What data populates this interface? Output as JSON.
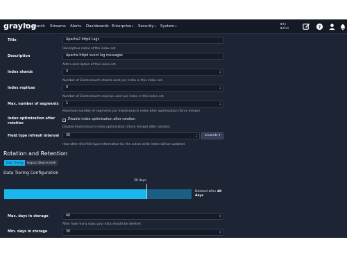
{
  "navbar": {
    "brand": "graylog",
    "items": [
      {
        "label": "Search",
        "dropdown": false
      },
      {
        "label": "Streams",
        "dropdown": false
      },
      {
        "label": "Alerts",
        "dropdown": false
      },
      {
        "label": "Dashboards",
        "dropdown": false
      },
      {
        "label": "Enterprise",
        "dropdown": true
      },
      {
        "label": "Security",
        "dropdown": true
      },
      {
        "label": "System",
        "dropdown": true
      }
    ],
    "throughput_in": "In",
    "throughput_out": "Out",
    "icons": [
      "edit-icon",
      "notifications-icon",
      "help-icon",
      "user-icon"
    ]
  },
  "form": {
    "title": {
      "label": "Title",
      "value": "Apache2 httpd Logs",
      "help": "Descriptive name of the index set."
    },
    "description": {
      "label": "Description",
      "value": "Apache httpd event log messages",
      "help": "Add a description of this index set."
    },
    "shards": {
      "label": "Index shards",
      "value": "4",
      "help": "Number of Elasticsearch shards used per index in this index set."
    },
    "replicas": {
      "label": "Index replicas",
      "value": "0",
      "help": "Number of Elasticsearch replicas used per index in this index set."
    },
    "segments": {
      "label": "Max. number of segments",
      "value": "1",
      "help": "Maximum number of segments per Elasticsearch index after optimization (force merge)."
    },
    "optimization": {
      "label": "Index optimization after rotation",
      "checkbox_label": "Disable index optimization after rotation",
      "checked": false,
      "help": "Disable Elasticsearch index optimization (force merge) after rotation."
    },
    "refresh": {
      "label": "Field type refresh interval",
      "value": "30",
      "unit": "seconds",
      "help": "How often the field type information for the active write index will be updated."
    }
  },
  "rotation": {
    "title": "Rotation and Retention",
    "tabs": [
      {
        "label": "Data Tiering",
        "active": true
      },
      {
        "label": "Legacy (Deprecated)",
        "active": false
      }
    ],
    "config_title": "Data Tiering Configuration",
    "tier_marker_label": "30 days",
    "tier_fill_fraction": 0.76,
    "legend_prefix": "Deleted after",
    "legend_value": "40",
    "legend_unit": "days",
    "max_days": {
      "label": "Max. days in storage",
      "value": "40",
      "help": "After how many days your data should be deleted."
    },
    "min_days": {
      "label": "Min. days in storage",
      "value": "30"
    }
  },
  "colors": {
    "navbar": "#141a25",
    "background": "#1d2433",
    "accent": "#17b3ee",
    "tier_bar_remaining": "#1b5f85"
  }
}
